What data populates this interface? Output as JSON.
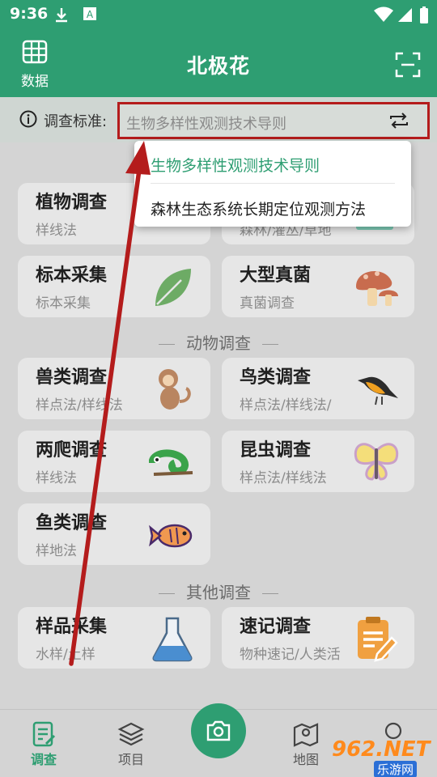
{
  "status_bar": {
    "time": "9:36"
  },
  "header": {
    "title": "北极花",
    "data_label": "数据"
  },
  "standard": {
    "label": "调查标准:",
    "value": "生物多样性观测技术导则"
  },
  "dropdown": {
    "options": [
      "生物多样性观测技术导则",
      "森林生态系统长期定位观测方法"
    ],
    "selected": "生物多样性观测技术导则"
  },
  "sections": {
    "animal": "动物调查",
    "other": "其他调查"
  },
  "cards": [
    {
      "title": "植物调查",
      "subtitle": "样线法",
      "icon": "plant-icon"
    },
    {
      "title": "",
      "subtitle": "森林/灌丛/草地",
      "icon": "vegetation-icon"
    },
    {
      "title": "标本采集",
      "subtitle": "标本采集",
      "icon": "leaf-icon"
    },
    {
      "title": "大型真菌",
      "subtitle": "真菌调查",
      "icon": "mushroom-icon"
    },
    {
      "title": "兽类调查",
      "subtitle": "样点法/样线法",
      "icon": "monkey-icon"
    },
    {
      "title": "鸟类调查",
      "subtitle": "样点法/样线法/",
      "icon": "bird-icon"
    },
    {
      "title": "两爬调查",
      "subtitle": "样线法",
      "icon": "chameleon-icon"
    },
    {
      "title": "昆虫调查",
      "subtitle": "样点法/样线法",
      "icon": "butterfly-icon"
    },
    {
      "title": "鱼类调查",
      "subtitle": "样地法",
      "icon": "fish-icon"
    },
    {
      "title": "样品采集",
      "subtitle": "水样/土样",
      "icon": "flask-icon"
    },
    {
      "title": "速记调查",
      "subtitle": "物种速记/人类活",
      "icon": "notepad-icon"
    }
  ],
  "bottom_nav": {
    "items": [
      "调查",
      "项目",
      "地图",
      ""
    ],
    "active": "调查"
  },
  "watermark": {
    "text": "962.NET",
    "sub": "乐游网"
  },
  "colors": {
    "brand": "#2e9e72",
    "annotation": "#b41c1c"
  }
}
